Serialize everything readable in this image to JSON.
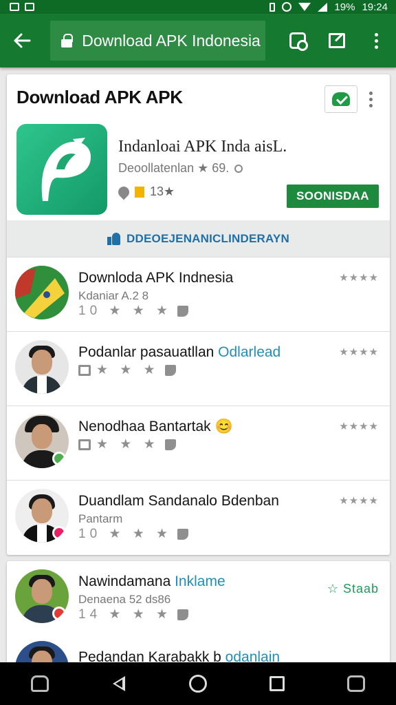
{
  "status_bar": {
    "battery": "19%",
    "time": "19:24"
  },
  "toolbar": {
    "url": "Download APK Indonesia"
  },
  "card": {
    "title": "Download APK APK",
    "app_name": "Indanloai APK Inda aisL.",
    "developer": "Deoollatenlan ★ 69.",
    "rating_count": "13★",
    "install_label": "SOONISDAA",
    "banner_text": "DDEOEJENANICLINDERAYN"
  },
  "list": {
    "items": [
      {
        "title": "Downloda APK Indnesia",
        "subtitle": "Kdaniar A.2 8",
        "meta": "10 ★ ★ ★",
        "rating": "★★★★"
      },
      {
        "title": "Podanlar pasauatllan",
        "link": "Odlarlead",
        "meta": "★ ★ ★",
        "rating": "★★★★"
      },
      {
        "title": "Nenodhaa Bantartak 😊",
        "meta": "★ ★ ★",
        "rating": "★★★★"
      },
      {
        "title": "Duandlam Sandanalo Bdenban",
        "subtitle": "Pantarm",
        "meta": "10 ★ ★ ★",
        "rating": "★★★★"
      }
    ]
  },
  "card2": {
    "items": [
      {
        "title": "Nawindamana",
        "link": "Inklame",
        "subtitle": "Denaena 52 ds86",
        "meta": "14 ★ ★ ★",
        "action": "☆ Staab"
      },
      {
        "title": "Pedandan Karabakk b",
        "link": "odanlain"
      }
    ]
  },
  "colors": {
    "status_bar": "#0e6b26",
    "app_bar": "#157a2f",
    "install": "#1d8a3d",
    "banner_text": "#1f6fa8",
    "link": "#1f8fb8",
    "logo": "#2fc58d"
  },
  "icons": {
    "toolbar": [
      "arrow-left-icon",
      "lock-icon",
      "tab-switcher-icon",
      "edit-icon",
      "more-vert-icon"
    ],
    "nav": [
      "game-icon",
      "back-icon",
      "home-icon",
      "recents-icon",
      "screenshot-icon"
    ]
  }
}
